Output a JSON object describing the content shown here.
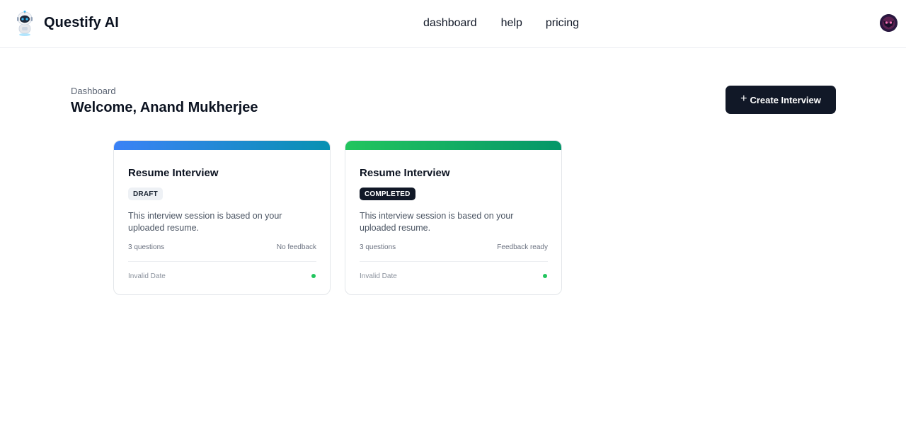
{
  "header": {
    "brand": "Questify AI",
    "logo_icon": "robot-icon",
    "nav": [
      {
        "label": "dashboard"
      },
      {
        "label": "help"
      },
      {
        "label": "pricing"
      }
    ],
    "avatar_icon": "user-avatar-icon"
  },
  "main": {
    "breadcrumb": "Dashboard",
    "title": "Welcome, Anand Mukherjee",
    "create_button": {
      "icon": "plus-icon",
      "label": "Create Interview"
    }
  },
  "cards": [
    {
      "title": "Resume Interview",
      "status": "DRAFT",
      "accent_gradient": [
        "#3b82f6",
        "#0891b2"
      ],
      "description": "This interview session is based on your uploaded resume.",
      "questions": "3 questions",
      "feedback": "No feedback",
      "date": "Invalid Date",
      "indicator_color": "#22c55e"
    },
    {
      "title": "Resume Interview",
      "status": "COMPLETED",
      "accent_gradient": [
        "#22c55e",
        "#059669"
      ],
      "description": "This interview session is based on your uploaded resume.",
      "questions": "3 questions",
      "feedback": "Feedback ready",
      "date": "Invalid Date",
      "indicator_color": "#22c55e"
    }
  ]
}
